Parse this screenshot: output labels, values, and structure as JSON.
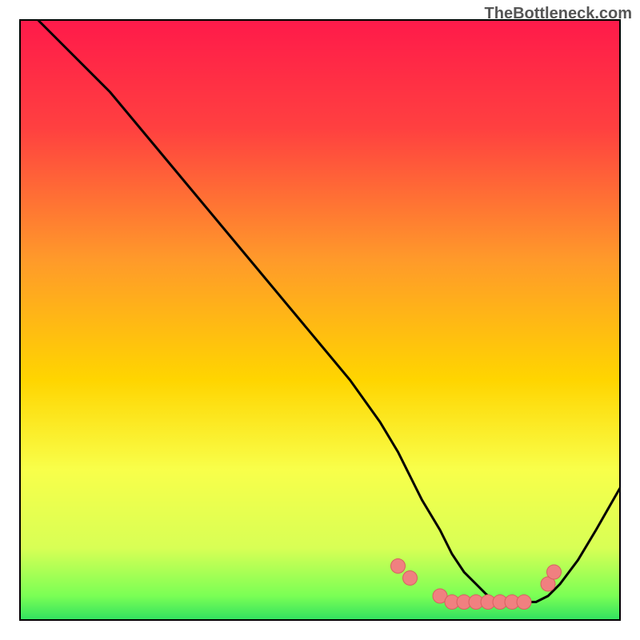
{
  "watermark": "TheBottleneck.com",
  "chart_data": {
    "type": "line",
    "title": "",
    "xlabel": "",
    "ylabel": "",
    "xlim": [
      0,
      100
    ],
    "ylim": [
      0,
      100
    ],
    "x": [
      3,
      8,
      15,
      20,
      25,
      30,
      35,
      40,
      45,
      50,
      55,
      60,
      63,
      65,
      67,
      70,
      72,
      74,
      76,
      78,
      80,
      82,
      84,
      86,
      88,
      90,
      93,
      96,
      100
    ],
    "values": [
      100,
      95,
      88,
      82,
      76,
      70,
      64,
      58,
      52,
      46,
      40,
      33,
      28,
      24,
      20,
      15,
      11,
      8,
      6,
      4,
      3,
      3,
      3,
      3,
      4,
      6,
      10,
      15,
      22
    ],
    "markers_x": [
      63,
      65,
      70,
      72,
      74,
      76,
      78,
      80,
      82,
      84,
      88,
      89
    ],
    "markers_y": [
      9,
      7,
      4,
      3,
      3,
      3,
      3,
      3,
      3,
      3,
      6,
      8
    ],
    "note": "Bottleneck curve: V-shaped, minimum around x=78-84. Markers (salmon dots) cluster near minimum valley.",
    "gradient_stops": [
      {
        "offset": 0,
        "color": "#ff1a4a"
      },
      {
        "offset": 0.18,
        "color": "#ff4040"
      },
      {
        "offset": 0.4,
        "color": "#ff9a2a"
      },
      {
        "offset": 0.6,
        "color": "#ffd500"
      },
      {
        "offset": 0.75,
        "color": "#f8ff4a"
      },
      {
        "offset": 0.88,
        "color": "#d8ff55"
      },
      {
        "offset": 0.96,
        "color": "#7aff55"
      },
      {
        "offset": 1.0,
        "color": "#30e060"
      }
    ],
    "curve_color": "#000000",
    "marker_fill": "#f08080",
    "marker_stroke": "#d86060",
    "frame_color": "#000000"
  }
}
